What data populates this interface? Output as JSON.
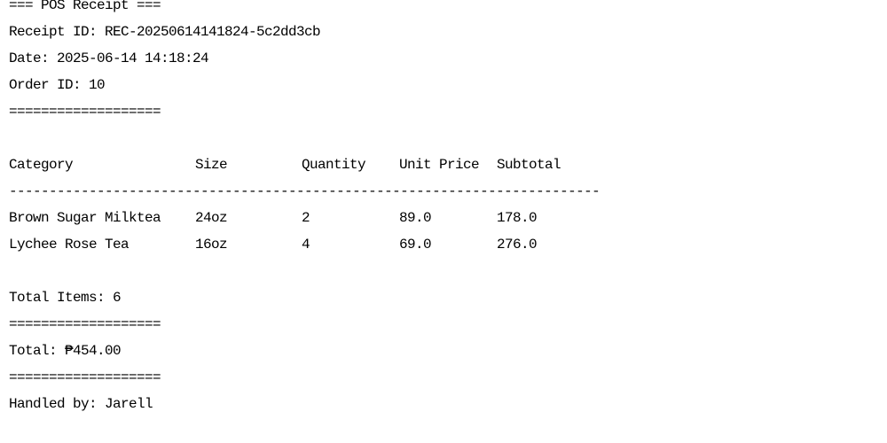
{
  "receipt": {
    "header": "=== POS Receipt ===",
    "receipt_id_line": "Receipt ID: REC-20250614141824-5c2dd3cb",
    "date_line": "Date: 2025-06-14 14:18:24",
    "order_id_line": "Order ID: 10",
    "separator": "===================",
    "table": {
      "columns": [
        "Category",
        "Size",
        "Quantity",
        "Unit Price",
        "Subtotal"
      ],
      "divider": "--------------------------------------------------------------------------",
      "rows": [
        [
          "Brown Sugar Milktea",
          "24oz",
          "2",
          "89.0",
          "178.0"
        ],
        [
          "Lychee Rose Tea",
          "16oz",
          "4",
          "69.0",
          "276.0"
        ]
      ]
    },
    "total_items_line": "Total Items: 6",
    "total_line": "Total: ₱454.00",
    "handled_by_line": "Handled by: Jarell"
  }
}
